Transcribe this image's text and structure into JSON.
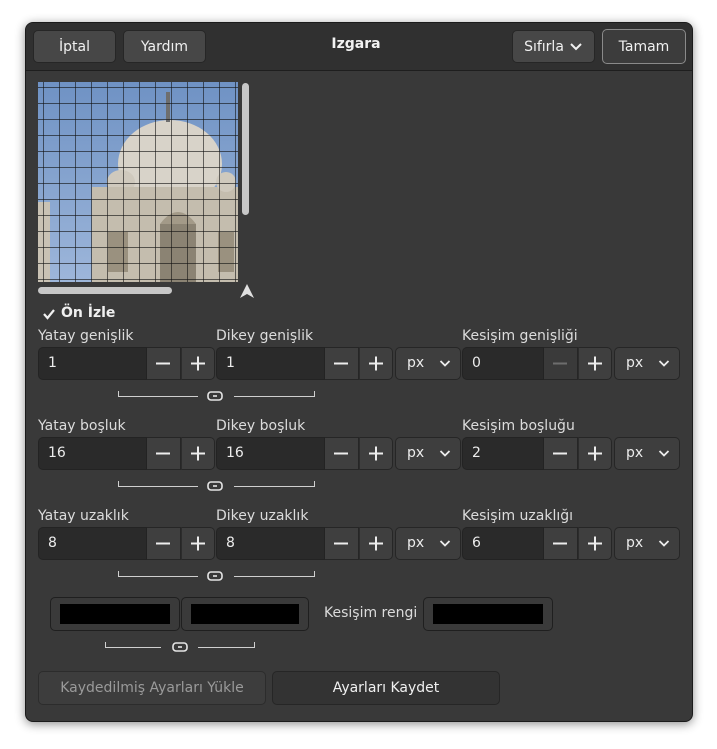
{
  "header": {
    "cancel_label": "İptal",
    "help_label": "Yardım",
    "title": "Izgara",
    "reset_label": "Sıfırla",
    "ok_label": "Tamam"
  },
  "preview": {
    "toggle_label": "Ön İzle",
    "toggle_checked": true
  },
  "rows": [
    {
      "h_label": "Yatay genişlik",
      "h_value": "1",
      "v_label": "Dikey genişlik",
      "v_value": "1",
      "unit": "px",
      "i_label": "Kesişim genişliği",
      "i_value": "0",
      "i_unit": "px"
    },
    {
      "h_label": "Yatay boşluk",
      "h_value": "16",
      "v_label": "Dikey boşluk",
      "v_value": "16",
      "unit": "px",
      "i_label": "Kesişim boşluğu",
      "i_value": "2",
      "i_unit": "px"
    },
    {
      "h_label": "Yatay uzaklık",
      "h_value": "8",
      "v_label": "Dikey uzaklık",
      "v_value": "8",
      "unit": "px",
      "i_label": "Kesişim uzaklığı",
      "i_value": "6",
      "i_unit": "px"
    }
  ],
  "colors": {
    "intersection_label": "Kesişim rengi",
    "h_color": "#000000",
    "v_color": "#000000",
    "i_color": "#000000"
  },
  "footer": {
    "load_label": "Kaydedilmiş Ayarları Yükle",
    "save_label": "Ayarları Kaydet"
  }
}
